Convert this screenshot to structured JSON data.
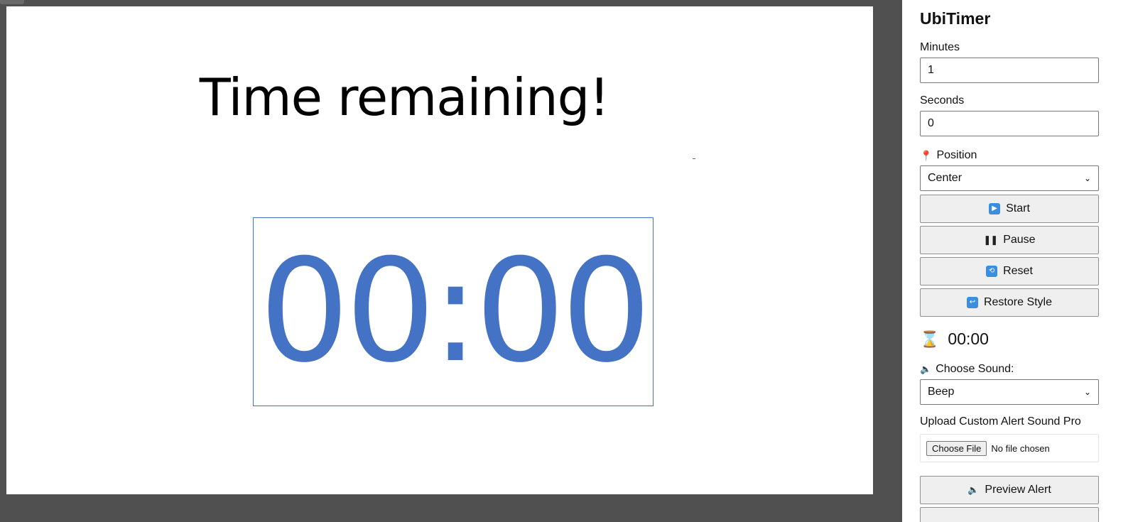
{
  "slide": {
    "title": "Time remaining!",
    "timer_display": "00:00",
    "timer_color": "#4472c4"
  },
  "panel": {
    "app_title": "UbiTimer",
    "minutes": {
      "label": "Minutes",
      "value": "1"
    },
    "seconds": {
      "label": "Seconds",
      "value": "0"
    },
    "position": {
      "label": "Position",
      "icon": "pin-icon",
      "selected": "Center"
    },
    "buttons": {
      "start": {
        "label": "Start",
        "icon": "play-icon"
      },
      "pause": {
        "label": "Pause",
        "icon": "pause-icon"
      },
      "reset": {
        "label": "Reset",
        "icon": "repeat-icon"
      },
      "restore_style": {
        "label": "Restore Style",
        "icon": "undo-icon"
      },
      "preview_alert": {
        "label": "Preview Alert",
        "icon": "speaker-icon"
      }
    },
    "status": {
      "icon": "hourglass-icon",
      "time": "00:00"
    },
    "sound": {
      "label": "Choose Sound:",
      "icon": "speaker-icon",
      "selected": "Beep"
    },
    "upload": {
      "label": "Upload Custom Alert Sound Pro",
      "button_label": "Choose File",
      "status": "No file chosen"
    },
    "accent_color": "#3b8de0"
  }
}
